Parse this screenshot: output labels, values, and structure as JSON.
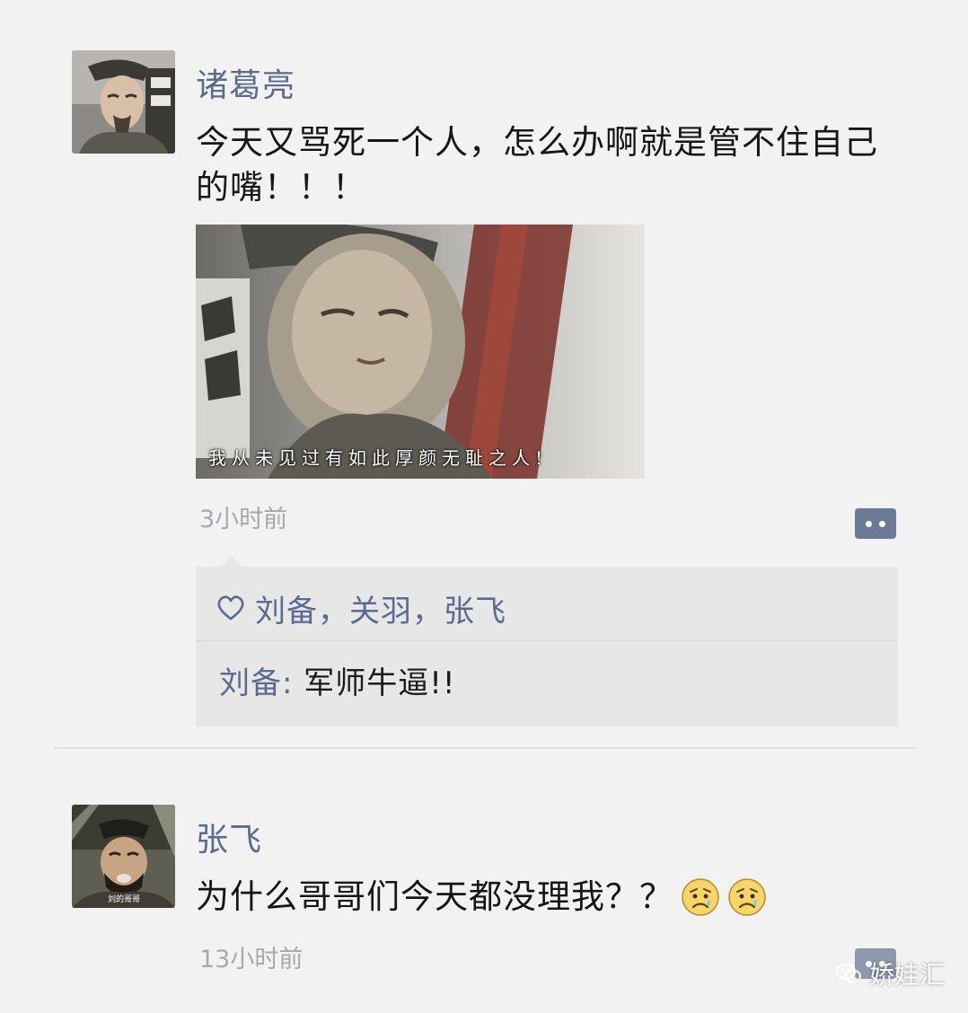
{
  "posts": [
    {
      "author": "诸葛亮",
      "text": "今天又骂死一个人，怎么办啊就是管不住自己的嘴！！！",
      "photo": {
        "subtitle": "我从未见过有如此厚颜无耻之人!"
      },
      "timestamp": "3小时前",
      "likes": "刘备，关羽，张飞",
      "comments": [
        {
          "author": "刘备",
          "separator": ": ",
          "text": "军师牛逼!!"
        }
      ]
    },
    {
      "author": "张飞",
      "text": "为什么哥哥们今天都没理我？？",
      "emojis": [
        "worried-face-icon",
        "worried-face-icon"
      ],
      "avatar_caption": "刘的哥哥",
      "timestamp": "13小时前"
    }
  ],
  "watermark": {
    "text": "娇娃汇",
    "icon": "wechat-icon"
  },
  "colors": {
    "background": "#f3f2f2",
    "name_blue": "#5b6a8f",
    "timestamp_gray": "#a9a9ad",
    "interaction_box": "#e8e7e8",
    "comment_button": "#6d7a96"
  }
}
